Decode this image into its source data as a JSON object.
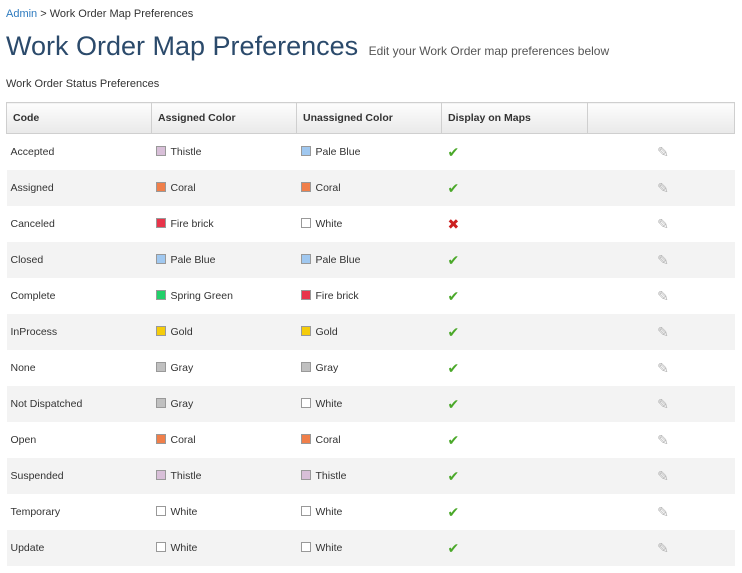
{
  "breadcrumb": {
    "parent": "Admin",
    "separator": ">",
    "current": "Work Order Map Preferences"
  },
  "header": {
    "title": "Work Order Map Preferences",
    "subtitle": "Edit your Work Order map preferences below"
  },
  "section_title": "Work Order Status Preferences",
  "table": {
    "columns": [
      "Code",
      "Assigned Color",
      "Unassigned Color",
      "Display on Maps",
      ""
    ],
    "rows": [
      {
        "code": "Accepted",
        "assigned": {
          "name": "Thistle",
          "hex": "#d8bfd8"
        },
        "unassigned": {
          "name": "Pale Blue",
          "hex": "#a0c8f0"
        },
        "display": true
      },
      {
        "code": "Assigned",
        "assigned": {
          "name": "Coral",
          "hex": "#f07f4a"
        },
        "unassigned": {
          "name": "Coral",
          "hex": "#f07f4a"
        },
        "display": true
      },
      {
        "code": "Canceled",
        "assigned": {
          "name": "Fire brick",
          "hex": "#e8344a"
        },
        "unassigned": {
          "name": "White",
          "hex": "#ffffff"
        },
        "display": false
      },
      {
        "code": "Closed",
        "assigned": {
          "name": "Pale Blue",
          "hex": "#a0c8f0"
        },
        "unassigned": {
          "name": "Pale Blue",
          "hex": "#a0c8f0"
        },
        "display": true
      },
      {
        "code": "Complete",
        "assigned": {
          "name": "Spring Green",
          "hex": "#22d06a"
        },
        "unassigned": {
          "name": "Fire brick",
          "hex": "#e8344a"
        },
        "display": true
      },
      {
        "code": "InProcess",
        "assigned": {
          "name": "Gold",
          "hex": "#f5cc0a"
        },
        "unassigned": {
          "name": "Gold",
          "hex": "#f5cc0a"
        },
        "display": true
      },
      {
        "code": "None",
        "assigned": {
          "name": "Gray",
          "hex": "#c0c0c0"
        },
        "unassigned": {
          "name": "Gray",
          "hex": "#c0c0c0"
        },
        "display": true
      },
      {
        "code": "Not Dispatched",
        "assigned": {
          "name": "Gray",
          "hex": "#c0c0c0"
        },
        "unassigned": {
          "name": "White",
          "hex": "#ffffff"
        },
        "display": true
      },
      {
        "code": "Open",
        "assigned": {
          "name": "Coral",
          "hex": "#f07f4a"
        },
        "unassigned": {
          "name": "Coral",
          "hex": "#f07f4a"
        },
        "display": true
      },
      {
        "code": "Suspended",
        "assigned": {
          "name": "Thistle",
          "hex": "#d8bfd8"
        },
        "unassigned": {
          "name": "Thistle",
          "hex": "#d8bfd8"
        },
        "display": true
      },
      {
        "code": "Temporary",
        "assigned": {
          "name": "White",
          "hex": "#ffffff"
        },
        "unassigned": {
          "name": "White",
          "hex": "#ffffff"
        },
        "display": true
      },
      {
        "code": "Update",
        "assigned": {
          "name": "White",
          "hex": "#ffffff"
        },
        "unassigned": {
          "name": "White",
          "hex": "#ffffff"
        },
        "display": true
      }
    ]
  },
  "icons": {
    "display_true": "check-icon",
    "display_false": "x-icon",
    "edit": "pencil-icon"
  },
  "colors": {
    "title": "#2b4a6b",
    "link": "#2e7bbf",
    "check": "#4aa829",
    "cross": "#cc1f1f"
  }
}
